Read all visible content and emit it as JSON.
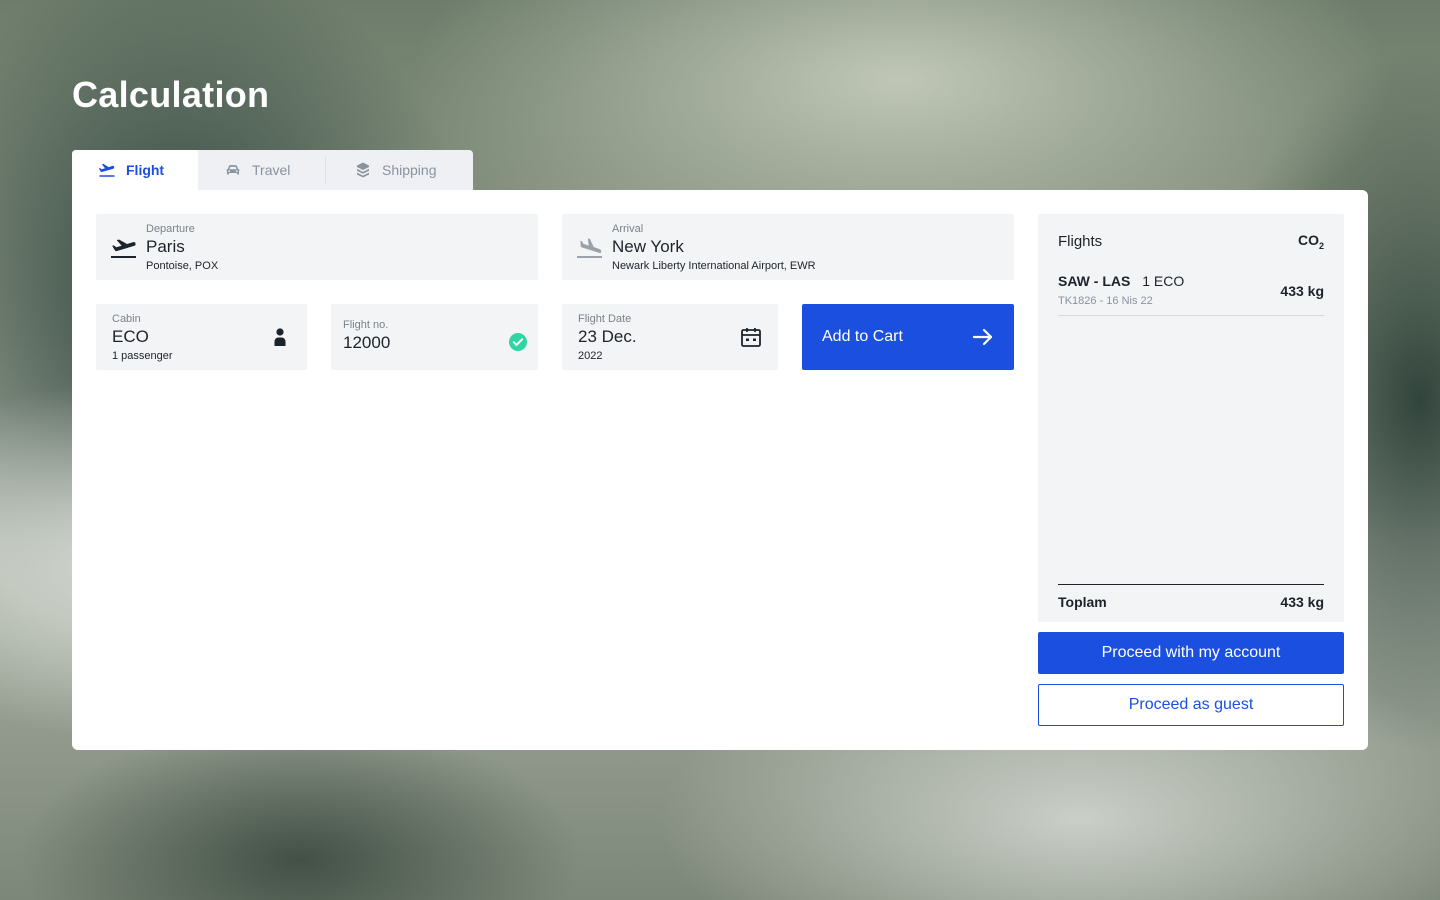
{
  "page": {
    "title": "Calculation"
  },
  "tabs": [
    {
      "label": "Flight",
      "icon": "plane-takeoff-icon",
      "active": true
    },
    {
      "label": "Travel",
      "icon": "car-icon",
      "active": false
    },
    {
      "label": "Shipping",
      "icon": "box-icon",
      "active": false
    }
  ],
  "departure": {
    "label": "Departure",
    "city": "Paris",
    "airport": "Pontoise, POX",
    "icon": "plane-takeoff-icon"
  },
  "arrival": {
    "label": "Arrival",
    "city": "New York",
    "airport": "Newark Liberty International Airport, EWR",
    "icon": "plane-landing-icon"
  },
  "cabin": {
    "label": "Cabin",
    "value": "ECO",
    "passengers": "1 passenger",
    "icon": "person-icon"
  },
  "flight_no": {
    "label": "Flight no.",
    "value": "12000",
    "icon": "check-circle-icon",
    "status_color": "#2fd6a3"
  },
  "flight_date": {
    "label": "Flight Date",
    "value": "23 Dec.",
    "year": "2022",
    "icon": "calendar-icon"
  },
  "add_to_cart": {
    "label": "Add to Cart",
    "icon": "arrow-right-icon"
  },
  "summary": {
    "title": "Flights",
    "co2_label": "CO",
    "co2_sub": "2",
    "legs": [
      {
        "route": "SAW - LAS",
        "class": "1 ECO",
        "meta": "TK1826 - 16 Nis 22",
        "co2": "433 kg"
      }
    ],
    "total_label": "Toplam",
    "total_value": "433 kg"
  },
  "actions": {
    "proceed_account": "Proceed with my account",
    "proceed_guest": "Proceed as guest"
  },
  "colors": {
    "accent": "#1a4fe0",
    "field_bg": "#f3f4f6",
    "success": "#2fd6a3"
  }
}
